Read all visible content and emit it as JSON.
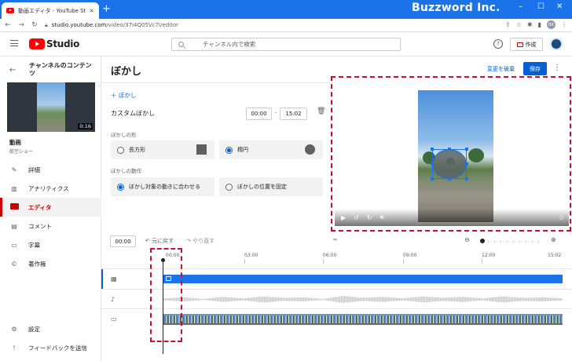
{
  "browser": {
    "tab_title": "動画エディタ - YouTube Studio",
    "tab_close": "×",
    "new_tab": "+",
    "brand_overlay": "Buzzword Inc.",
    "url_host": "studio.youtube.com",
    "url_path": "/video/37i4Q05Vc7I/editor",
    "profile_initials": "BR",
    "window_controls": [
      "–",
      "☐",
      "✕"
    ]
  },
  "header": {
    "logo_text": "Studio",
    "search_placeholder": "チャンネル内で検索",
    "create_label": "作成",
    "help": "?"
  },
  "sidebar": {
    "title": "チャンネルのコンテンツ",
    "thumb_duration": "0:16",
    "video_label": "動画",
    "video_sub": "航空ショー",
    "items": [
      {
        "label": "詳細",
        "icon": "pencil-icon"
      },
      {
        "label": "アナリティクス",
        "icon": "analytics-icon"
      },
      {
        "label": "エディタ",
        "icon": "editor-icon"
      },
      {
        "label": "コメント",
        "icon": "comment-icon"
      },
      {
        "label": "字幕",
        "icon": "subtitles-icon"
      },
      {
        "label": "著作権",
        "icon": "copyright-icon"
      }
    ],
    "bottom": [
      {
        "label": "設定",
        "icon": "gear-icon"
      },
      {
        "label": "フィードバックを送信",
        "icon": "feedback-icon"
      }
    ]
  },
  "editor": {
    "title": "ぼかし",
    "discard_label": "変更を破棄",
    "save_label": "保存",
    "add_blur_label": "ぼかし",
    "custom_blur_label": "カスタムぼかし",
    "start_time": "00:00",
    "end_time": "15:02",
    "shape_section": "ぼかしの形",
    "shape_rect": "長方形",
    "shape_ellipse": "楕円",
    "motion_section": "ぼかしの動作",
    "motion_follow": "ぼかし対象の動きに合わせる",
    "motion_fixed": "ぼかしの位置を固定",
    "selected_shape": "ellipse",
    "selected_motion": "follow"
  },
  "timeline": {
    "current_time": "00:00",
    "undo_label": "元に戻す",
    "redo_label": "やり直す",
    "ticks": [
      "00:00",
      "03:00",
      "06:00",
      "09:00",
      "12:00",
      "15:02"
    ],
    "zoom_minus": "⊖",
    "zoom_plus": "⊕"
  },
  "colors": {
    "accent": "#065fd4",
    "brand_red": "#ff0000",
    "annotation_red": "#c8102e",
    "chrome_blue": "#1a73e8"
  }
}
